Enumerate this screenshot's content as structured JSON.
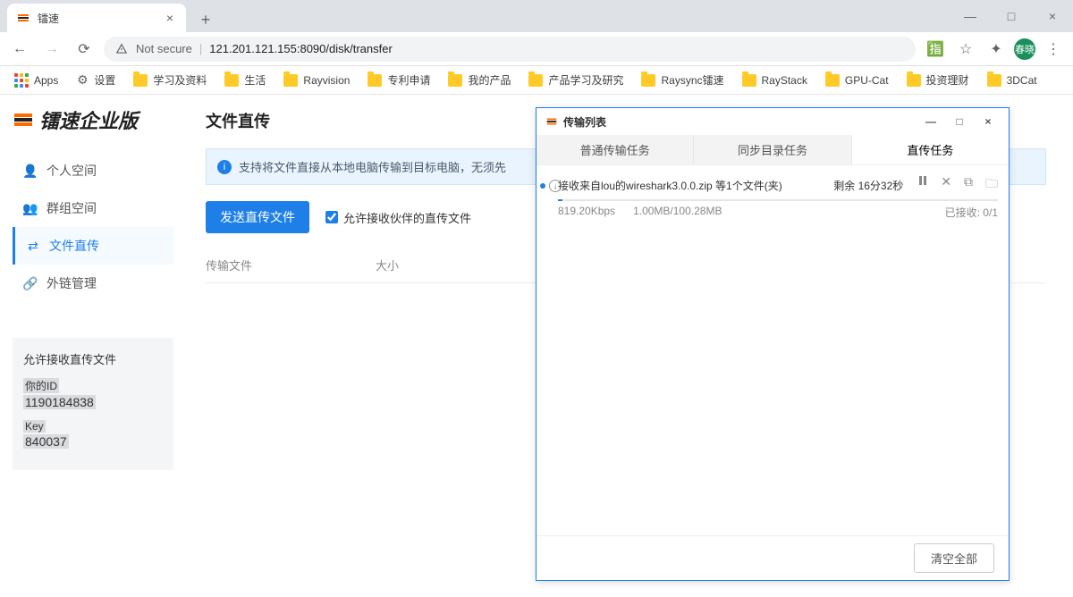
{
  "window": {
    "tab_title": "镭速",
    "minimize": "—",
    "maximize": "□",
    "close": "×"
  },
  "addr": {
    "not_secure": "Not secure",
    "url": "121.201.121.155:8090/disk/transfer",
    "avatar_text": "春晓"
  },
  "bookmarks": {
    "apps": "Apps",
    "items": [
      "设置",
      "学习及资料",
      "生活",
      "Rayvision",
      "专利申请",
      "我的产品",
      "产品学习及研究",
      "Raysync镭速",
      "RayStack",
      "GPU-Cat",
      "投资理财",
      "3DCat"
    ]
  },
  "page": {
    "logo_text": "镭速企业版",
    "nav": {
      "personal": "个人空间",
      "group": "群组空间",
      "direct": "文件直传",
      "link": "外链管理"
    },
    "title": "文件直传",
    "notice": "支持将文件直接从本地电脑传输到目标电脑，无须先",
    "send_btn": "发送直传文件",
    "allow_recv": "允许接收伙伴的直传文件",
    "tbl": {
      "file": "传输文件",
      "size": "大小"
    },
    "card": {
      "title": "允许接收直传文件",
      "id_lbl": "你的ID",
      "id_val": "1190184838",
      "key_lbl": "Key",
      "key_val": "840037"
    }
  },
  "popup": {
    "title": "传输列表",
    "tabs": {
      "normal": "普通传输任务",
      "sync": "同步目录任务",
      "direct": "直传任务"
    },
    "task": {
      "desc": "接收来自lou的wireshark3.0.0.zip  等1个文件(夹)",
      "remain": "剩余 16分32秒",
      "speed": "819.20Kbps",
      "progress_text": "1.00MB/100.28MB",
      "received": "已接收: 0/1",
      "progress_pct": 1
    },
    "clear_all": "清空全部"
  }
}
